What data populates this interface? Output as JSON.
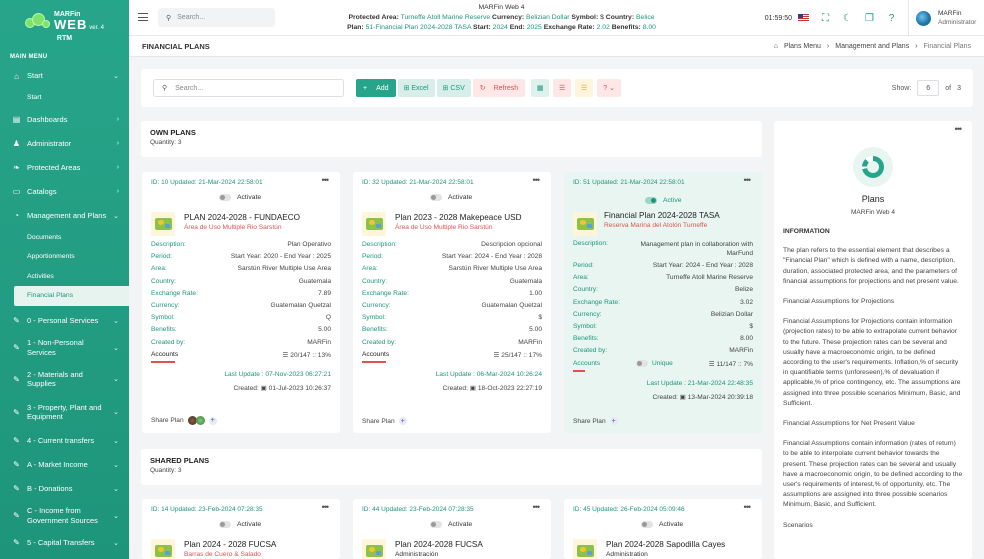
{
  "app": {
    "logo_brand": "MARFin",
    "logo_web": "WEB",
    "logo_version": "ver. 4",
    "org": "RTM"
  },
  "sidebar": {
    "main_menu": "MAIN MENU",
    "items": [
      {
        "label": "Start",
        "icon": "home-icon"
      },
      {
        "label": "Start",
        "sub": true
      },
      {
        "label": "Dashboards",
        "icon": "chart-icon"
      },
      {
        "label": "Administrator",
        "icon": "user-icon"
      },
      {
        "label": "Protected Areas",
        "icon": "leaf-icon"
      },
      {
        "label": "Catalogs",
        "icon": "folder-icon"
      },
      {
        "label": "Management and Plans",
        "icon": "gauge-icon"
      }
    ],
    "sub_items": [
      "Documents",
      "Apportionments",
      "Activities",
      "Financial Plans"
    ],
    "finance_items": [
      "0 - Personal Services",
      "1 - Non-Personal Services",
      "2 - Materials and Supplies",
      "3 - Property, Plant and Equipment",
      "4 - Current transfers",
      "A - Market Income",
      "B - Donations",
      "C - Income from Government Sources",
      "5 - Capital Transfers"
    ]
  },
  "topbar": {
    "search_placeholder": "Search...",
    "app_name": "MARFin Web 4",
    "protected_area_label": "Protected Area:",
    "protected_area": "Turneffe Atoll Marine Reserve",
    "currency_label": "Currency:",
    "currency": "Belizian Dollar",
    "symbol_label": "Symbol:",
    "symbol": "$",
    "country_label": "Country:",
    "country": "Belice",
    "plan_label": "Plan:",
    "plan": "51-Financial Plan 2024-2028 TASA",
    "start_label": "Start:",
    "start": "2024",
    "end_label": "End:",
    "end": "2025",
    "rate_label": "Exchange Rate:",
    "rate": "2.02",
    "benefits_label": "Benefits:",
    "benefits": "8.00",
    "clock": "01:59:50",
    "user_name": "MARFin",
    "user_role": "Administrator"
  },
  "titlebar": {
    "title": "FINANCIAL PLANS",
    "crumb1": "Plans Menu",
    "crumb2": "Management and Plans",
    "crumb3": "Financial Plans"
  },
  "toolbar": {
    "search_placeholder": "Search...",
    "add": "Add",
    "excel": "Excel",
    "csv": "CSV",
    "refresh": "Refresh",
    "show_label": "Show:",
    "show_value": "6",
    "of_label": "of",
    "of_value": "3"
  },
  "own": {
    "title": "OWN PLANS",
    "quantity": "Quantity: 3"
  },
  "shared": {
    "title": "SHARED PLANS",
    "quantity": "Quantity: 3"
  },
  "labels": {
    "description": "Description:",
    "period": "Period:",
    "area": "Area:",
    "country": "Country:",
    "rate": "Exchange Rate:",
    "currency": "Currency:",
    "symbol": "Symbol:",
    "benefits": "Benefits:",
    "created_by": "Created by:",
    "accounts": "Accounts",
    "share": "Share Plan"
  },
  "cards": [
    {
      "id": "ID: 10 Updated: 21-Mar-2024 22:58:01",
      "toggle": "Activate",
      "title": "PLAN 2024-2028 - FUNDAECO",
      "subtitle": "Área de Uso Multiple Rio Sarstún",
      "description": "Plan Operativo",
      "period": "Start Year: 2020 - End Year : 2025",
      "area": "Sarstún River Multiple Use Area",
      "country": "Guatemala",
      "rate": "7.89",
      "currency": "Guatemalan Quetzal",
      "symbol": "Q",
      "benefits": "5.00",
      "created_by": "MARFin",
      "accounts_value": "20/147 :: 13%",
      "last_update": "Last Update : 07-Nov-2023 06:27:21",
      "created": "01-Jul-2023 10:26:37"
    },
    {
      "id": "ID: 32 Updated: 21-Mar-2024 22:58:01",
      "toggle": "Activate",
      "title": "Plan 2023 - 2028 Makepeace USD",
      "subtitle": "Área de Uso Multiple Rio Sarstún",
      "description": "Descripcion opcional",
      "period": "Start Year: 2024 - End Year : 2028",
      "area": "Sarstún River Multiple Use Area",
      "country": "Guatemala",
      "rate": "1.00",
      "currency": "Guatemalan Quetzal",
      "symbol": "$",
      "benefits": "5.00",
      "created_by": "MARFin",
      "accounts_value": "25/147 :: 17%",
      "last_update": "Last Update : 06-Mar-2024 10:26:24",
      "created": "18-Oct-2023 22:27:19"
    },
    {
      "id": "ID: 51 Updated: 21-Mar-2024 22:58:01",
      "toggle": "Active",
      "title": "Financial Plan 2024-2028 TASA",
      "subtitle": "Reserva Marina del Atolón Turneffe",
      "description": "Management plan in collaboration with MarFund",
      "period": "Start Year: 2024 - End Year : 2028",
      "area": "Turneffe Atoll Marine Reserve",
      "country": "Belize",
      "rate": "3.02",
      "currency": "Belizian Dollar",
      "symbol": "$",
      "benefits": "8.00",
      "created_by": "MARFin",
      "unique": "Unique",
      "accounts_value": "11/147 :: 7%",
      "last_update": "Last Update : 21-Mar-2024 22:48:35",
      "created": "13-Mar-2024 20:39:18"
    }
  ],
  "shared_cards": [
    {
      "id": "ID: 14 Updated: 23-Feb-2024 07:28:35",
      "toggle": "Activate",
      "title": "Plan 2024 - 2028 FUCSA",
      "subtitle": "Barras de Cuero & Salado"
    },
    {
      "id": "ID: 44 Updated: 23-Feb-2024 07:28:35",
      "toggle": "Activate",
      "title": "Plan 2024-2028 FUCSA",
      "subtitle": "Administración"
    },
    {
      "id": "ID: 45 Updated: 26-Feb-2024 05:09:46",
      "toggle": "Activate",
      "title": "Plan 2024-2028 Sapodilla Cayes",
      "subtitle": "Administration"
    }
  ],
  "info": {
    "title": "Plans",
    "subtitle": "MARFin Web 4",
    "heading": "INFORMATION",
    "p1": "The plan refers to the essential element that describes a \"Financial Plan\" which is defined with a name, description, duration, associated protected area, and the parameters of financial assumptions for projections and net present value.",
    "p2": "Financial Assumptions for Projections",
    "p3": "Financial Assumptions for Projections contain information (projection rates) to be able to extrapolate current behavior to the future. These projection rates can be several and usually have a macroeconomic origin, to be defined according to the user's requirements. Inflation,% of security in quantifiable terms (unforeseen),% of devaluation if applicable,% of price contingency, etc. The assumptions are assigned into three possible scenarios Minimum, Basic, and Sufficient.",
    "p4": "Financial Assumptions for Net Present Value",
    "p5": "Financial Assumptions contain information (rates of return) to be able to interpolate current behavior towards the present. These projection rates can be several and usually have a macroeconomic origin, to be defined according to the user's requirements of interest,% of opportunity, etc. The assumptions are assigned into three possible scenarios Minimum, Basic, and Sufficient.",
    "p6": "Scenarios"
  }
}
